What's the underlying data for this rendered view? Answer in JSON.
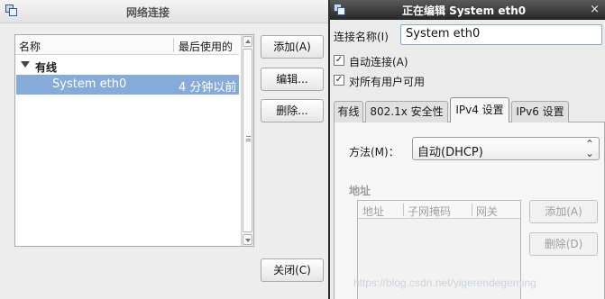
{
  "left_window": {
    "title": "网络连接",
    "list": {
      "col_name": "名称",
      "col_last_used": "最后使用的",
      "group": "有线",
      "rows": [
        {
          "name": "System eth0",
          "last_used": "4 分钟以前",
          "selected": true
        }
      ]
    },
    "buttons": {
      "add": "添加(A)",
      "edit": "编辑...",
      "delete": "删除...",
      "close": "关闭(C)"
    }
  },
  "right_window": {
    "title": "正在编辑 System eth0",
    "close_glyph": "×",
    "connection_name_label": "连接名称(I)",
    "connection_name_value": "System eth0",
    "auto_connect": {
      "label": "自动连接(A)",
      "checked": true
    },
    "all_users": {
      "label": "对所有用户可用",
      "checked": true
    },
    "tabs": [
      {
        "label": "有线",
        "active": false
      },
      {
        "label": "802.1x 安全性",
        "active": false
      },
      {
        "label": "IPv4 设置",
        "active": true
      },
      {
        "label": "IPv6 设置",
        "active": false
      }
    ],
    "ipv4": {
      "method_label": "方法(M)：",
      "method_value": "自动(DHCP)",
      "address_section_label": "地址",
      "address_columns": [
        "地址",
        "子网掩码",
        "网关"
      ],
      "add_button": "添加(A)",
      "delete_button": "删除(D)"
    }
  },
  "watermark": "https://blog.csdn.net/yigerendegeming",
  "check_glyph": "✓",
  "colors": {
    "selection": "#86abd9",
    "active_titlebar": "#2e2e2e",
    "disabled_text": "#a0a0a0"
  }
}
